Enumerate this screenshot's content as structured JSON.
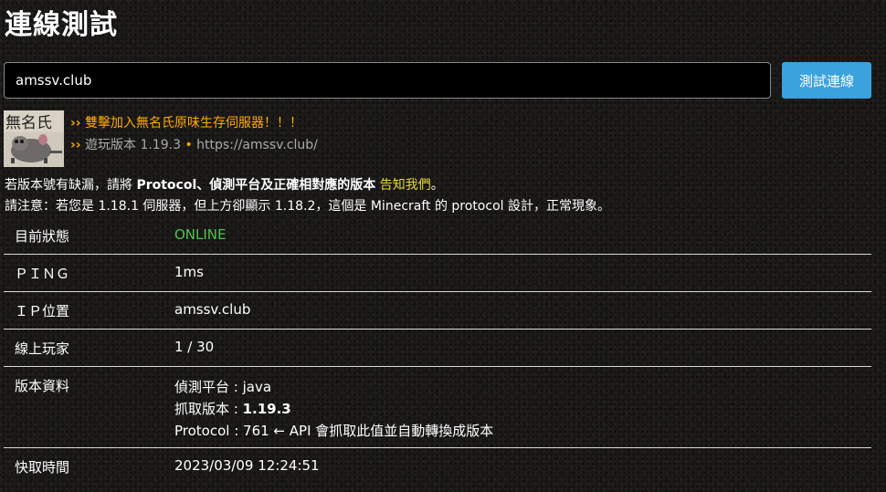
{
  "page": {
    "title": "連線測試"
  },
  "search": {
    "value": "amssv.club",
    "button_label": "測試連線"
  },
  "server": {
    "icon_text": "無名氏",
    "motd_line1": "雙擊加入無名氏原味生存伺服器！！！",
    "motd_chevron": "››",
    "motd_line2_version": "遊玩版本 1.19.3",
    "motd_line2_separator": "•",
    "motd_line2_url": "https://amssv.club/"
  },
  "notes": {
    "line1_prefix": "若版本號有缺漏，請將 ",
    "line1_bold": "Protocol、偵測平台及正確相對應的版本",
    "line1_space": " ",
    "line1_link": "告知我們",
    "line1_suffix": "。",
    "line2": "請注意：若您是 1.18.1 伺服器，但上方卻顯示 1.18.2，這個是 Minecraft 的 protocol 設計，正常現象。"
  },
  "table": {
    "status_label": "目前狀態",
    "status_value": "ONLINE",
    "ping_label": "ＰＩＮＧ",
    "ping_value": "1ms",
    "ip_label": "ＩＰ位置",
    "ip_value": "amssv.club",
    "players_label": "線上玩家",
    "players_value": "1 / 30",
    "version_label": "版本資料",
    "version_platform_prefix": "偵測平台 : ",
    "version_platform": "java",
    "version_fetch_prefix": "抓取版本 : ",
    "version_fetch": "1.19.3",
    "version_protocol": "Protocol : 761 ← API 會抓取此值並自動轉換成版本",
    "time_label": "快取時間",
    "time_value": "2023/03/09 12:24:51"
  },
  "colors": {
    "button": "#3aa2dc",
    "online": "#4ec24e",
    "motd_gold": "#ffaa00",
    "motd_gray": "#aaaaaa",
    "link_yellow": "#e6d43a"
  }
}
